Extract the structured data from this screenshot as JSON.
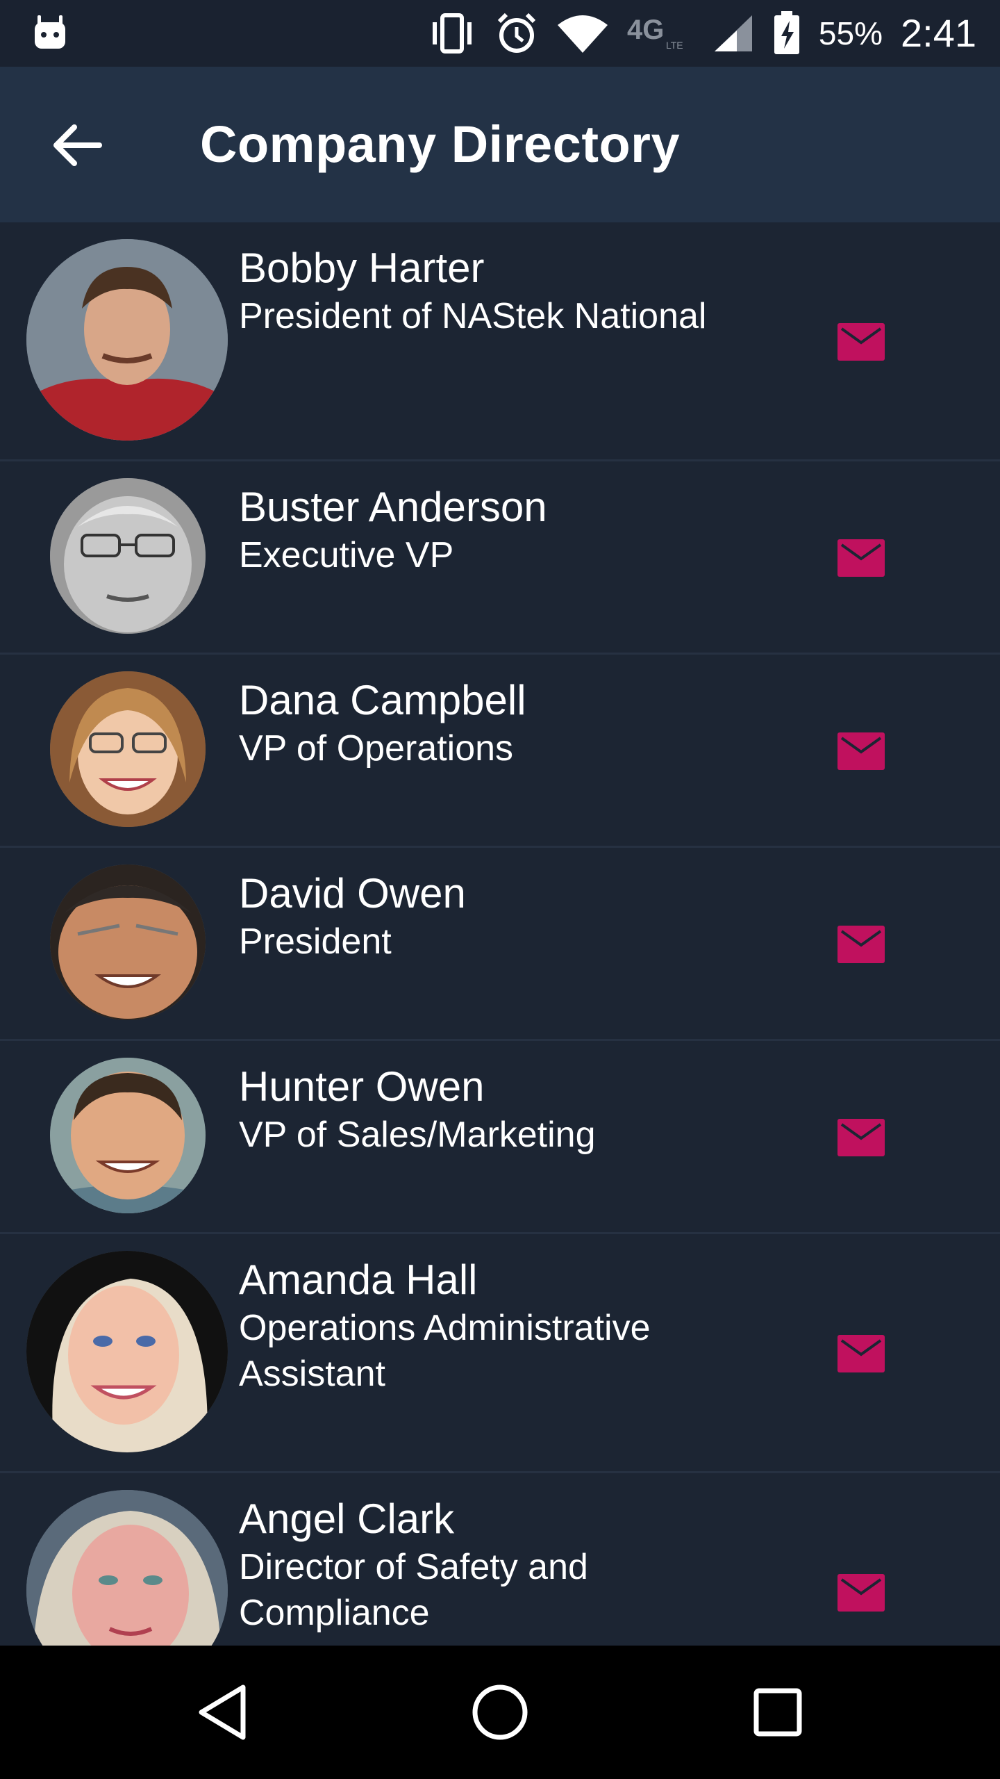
{
  "status": {
    "battery": "55%",
    "time": "2:41",
    "network": "4G LTE"
  },
  "header": {
    "title": "Company Directory"
  },
  "contacts": [
    {
      "name": "Bobby Harter",
      "title": "President of NAStek National"
    },
    {
      "name": "Buster Anderson",
      "title": "Executive VP"
    },
    {
      "name": "Dana Campbell",
      "title": "VP of Operations"
    },
    {
      "name": "David Owen",
      "title": "President"
    },
    {
      "name": "Hunter Owen",
      "title": "VP of Sales/Marketing"
    },
    {
      "name": "Amanda Hall",
      "title": "Operations Administrative Assistant"
    },
    {
      "name": "Angel Clark",
      "title": "Director of Safety and Compliance"
    }
  ],
  "colors": {
    "background": "#1c2533",
    "app_bar": "#233246",
    "status_bar": "#1a2230",
    "accent_mail": "#c0115e",
    "divider": "#263142",
    "nav_bar": "#000000"
  },
  "icons": {
    "back": "arrow-left-icon",
    "mail": "mail-icon",
    "nav_back": "triangle-back-icon",
    "nav_home": "circle-home-icon",
    "nav_recents": "square-recents-icon"
  }
}
